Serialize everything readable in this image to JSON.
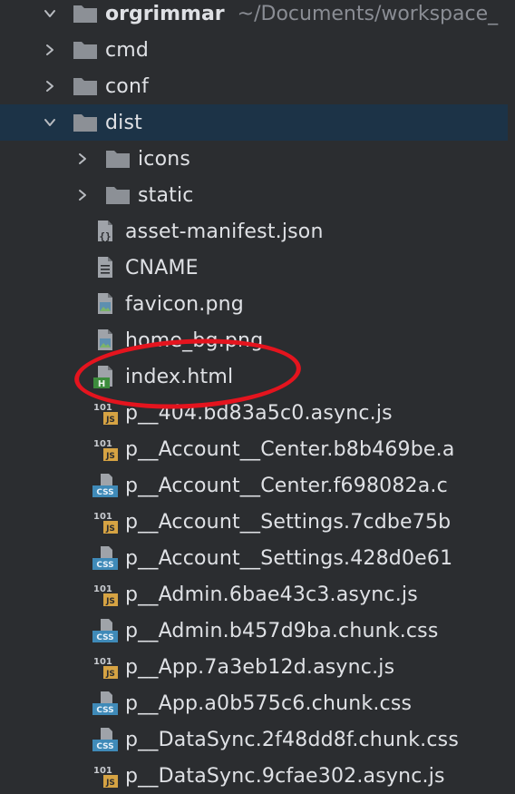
{
  "root": {
    "name": "orgrimmar",
    "path": "~/Documents/workspace_"
  },
  "items": [
    {
      "label": "cmd",
      "kind": "folder",
      "level": 1,
      "expanded": false
    },
    {
      "label": "conf",
      "kind": "folder",
      "level": 1,
      "expanded": false
    },
    {
      "label": "dist",
      "kind": "folder",
      "level": 1,
      "expanded": true,
      "selected": true
    },
    {
      "label": "icons",
      "kind": "folder",
      "level": 2,
      "expanded": false
    },
    {
      "label": "static",
      "kind": "folder",
      "level": 2,
      "expanded": false
    },
    {
      "label": "asset-manifest.json",
      "kind": "json",
      "level": 2
    },
    {
      "label": "CNAME",
      "kind": "text",
      "level": 2
    },
    {
      "label": "favicon.png",
      "kind": "image",
      "level": 2
    },
    {
      "label": "home_bg.png",
      "kind": "image",
      "level": 2
    },
    {
      "label": "index.html",
      "kind": "html",
      "level": 2,
      "annotated": true
    },
    {
      "label": "p__404.bd83a5c0.async.js",
      "kind": "js",
      "level": 2
    },
    {
      "label": "p__Account__Center.b8b469be.a",
      "kind": "js",
      "level": 2
    },
    {
      "label": "p__Account__Center.f698082a.c",
      "kind": "css",
      "level": 2
    },
    {
      "label": "p__Account__Settings.7cdbe75b",
      "kind": "js",
      "level": 2
    },
    {
      "label": "p__Account__Settings.428d0e61",
      "kind": "css",
      "level": 2
    },
    {
      "label": "p__Admin.6bae43c3.async.js",
      "kind": "js",
      "level": 2
    },
    {
      "label": "p__Admin.b457d9ba.chunk.css",
      "kind": "css",
      "level": 2
    },
    {
      "label": "p__App.7a3eb12d.async.js",
      "kind": "js",
      "level": 2
    },
    {
      "label": "p__App.a0b575c6.chunk.css",
      "kind": "css",
      "level": 2
    },
    {
      "label": "p__DataSync.2f48dd8f.chunk.css",
      "kind": "css",
      "level": 2
    },
    {
      "label": "p__DataSync.9cfae302.async.js",
      "kind": "js",
      "level": 2
    }
  ],
  "colors": {
    "background": "#2b2d30",
    "selected": "#1c3347",
    "folder": "#8c9096",
    "text": "#dfe1e5",
    "muted": "#8a8d94",
    "js_badge": "#d6a343",
    "css_badge": "#3f8ab8",
    "html_badge": "#3c8c3c",
    "annotation": "#e4141e"
  },
  "icon_glyphs": {
    "html": "H",
    "js": "JS",
    "css": "CSS",
    "binary": "101"
  }
}
